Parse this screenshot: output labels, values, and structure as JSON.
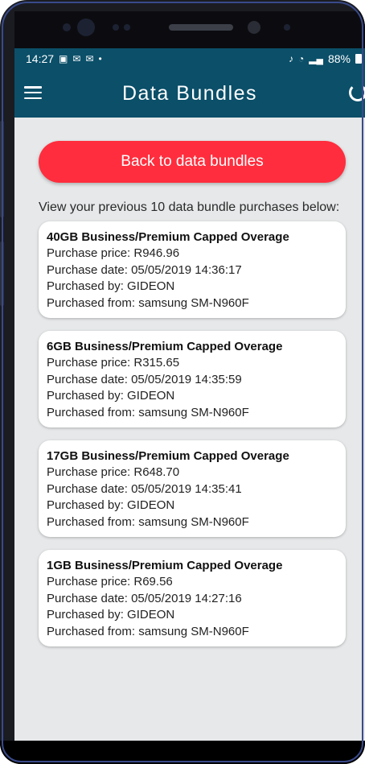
{
  "status_bar": {
    "time": "14:27",
    "left_icons": [
      "gallery-icon",
      "mail-icon",
      "mail-icon",
      "dot-icon"
    ],
    "battery_percent": "88%",
    "background_color": "#0b4f69"
  },
  "app_bar": {
    "title": "Data Bundles",
    "menu_icon": "hamburger-menu-icon",
    "refresh_icon": "refresh-icon"
  },
  "back_button": {
    "label": "Back to data bundles",
    "color": "#ff2d3d"
  },
  "intro_text": "View your previous 10 data bundle purchases below:",
  "purchases": [
    {
      "title": "40GB Business/Premium Capped Overage",
      "price": "Purchase price: R946.96",
      "date": "Purchase date: 05/05/2019 14:36:17",
      "by": "Purchased by: GIDEON",
      "from": "Purchased from: samsung SM-N960F"
    },
    {
      "title": "6GB Business/Premium Capped Overage",
      "price": "Purchase price: R315.65",
      "date": "Purchase date: 05/05/2019 14:35:59",
      "by": "Purchased by: GIDEON",
      "from": "Purchased from: samsung SM-N960F"
    },
    {
      "title": "17GB Business/Premium Capped Overage",
      "price": "Purchase price: R648.70",
      "date": "Purchase date: 05/05/2019 14:35:41",
      "by": "Purchased by: GIDEON",
      "from": "Purchased from: samsung SM-N960F"
    },
    {
      "title": "1GB Business/Premium Capped Overage",
      "price": "Purchase price: R69.56",
      "date": "Purchase date: 05/05/2019 14:27:16",
      "by": "Purchased by: GIDEON",
      "from": "Purchased from: samsung SM-N960F"
    }
  ]
}
